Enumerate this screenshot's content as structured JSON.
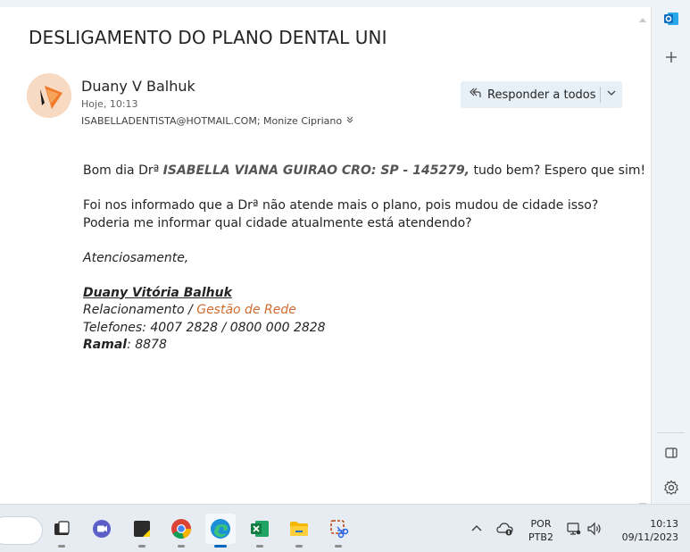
{
  "email": {
    "subject": "DESLIGAMENTO DO PLANO DENTAL UNI",
    "sender": "Duany V Balhuk",
    "time": "Hoje, 10:13",
    "recipients": "ISABELLADENTISTA@HOTMAIL.COM; Monize Cipriano",
    "reply_all_label": "Responder a todos",
    "body": {
      "greeting_start": "Bom dia Drª ",
      "greeting_name": "ISABELLA VIANA GUIRAO CRO: SP - 145279,",
      "greeting_end": " tudo bem?  Espero que sim!",
      "line1": "Foi nos informado que a Drª não atende mais o plano, pois mudou de cidade isso?",
      "line2": "Poderia me informar qual cidade atualmente está atendendo?",
      "closing": "Atenciosamente,",
      "sig_name": "Duany Vitória Balhuk ",
      "sig_role_prefix": "Relacionamento / ",
      "sig_role_dept": "Gestão de Rede",
      "sig_phones": "Telefones: 4007 2828 / 0800 000 2828",
      "sig_ext_label": "Ramal",
      "sig_ext_value": ": 8878"
    }
  },
  "taskbar": {
    "lang_top": "POR",
    "lang_bottom": "PTB2",
    "clock_time": "10:13",
    "clock_date": "09/11/2023",
    "apps": [
      "store-app-icon",
      "teams-icon",
      "sticky-notes-icon",
      "chrome-icon",
      "edge-icon",
      "excel-icon",
      "file-explorer-icon",
      "snipping-tool-icon"
    ]
  },
  "colors": {
    "accent": "#0f6cbd",
    "link_orange": "#d06b2f",
    "reply_bg": "#e8f0f7"
  }
}
